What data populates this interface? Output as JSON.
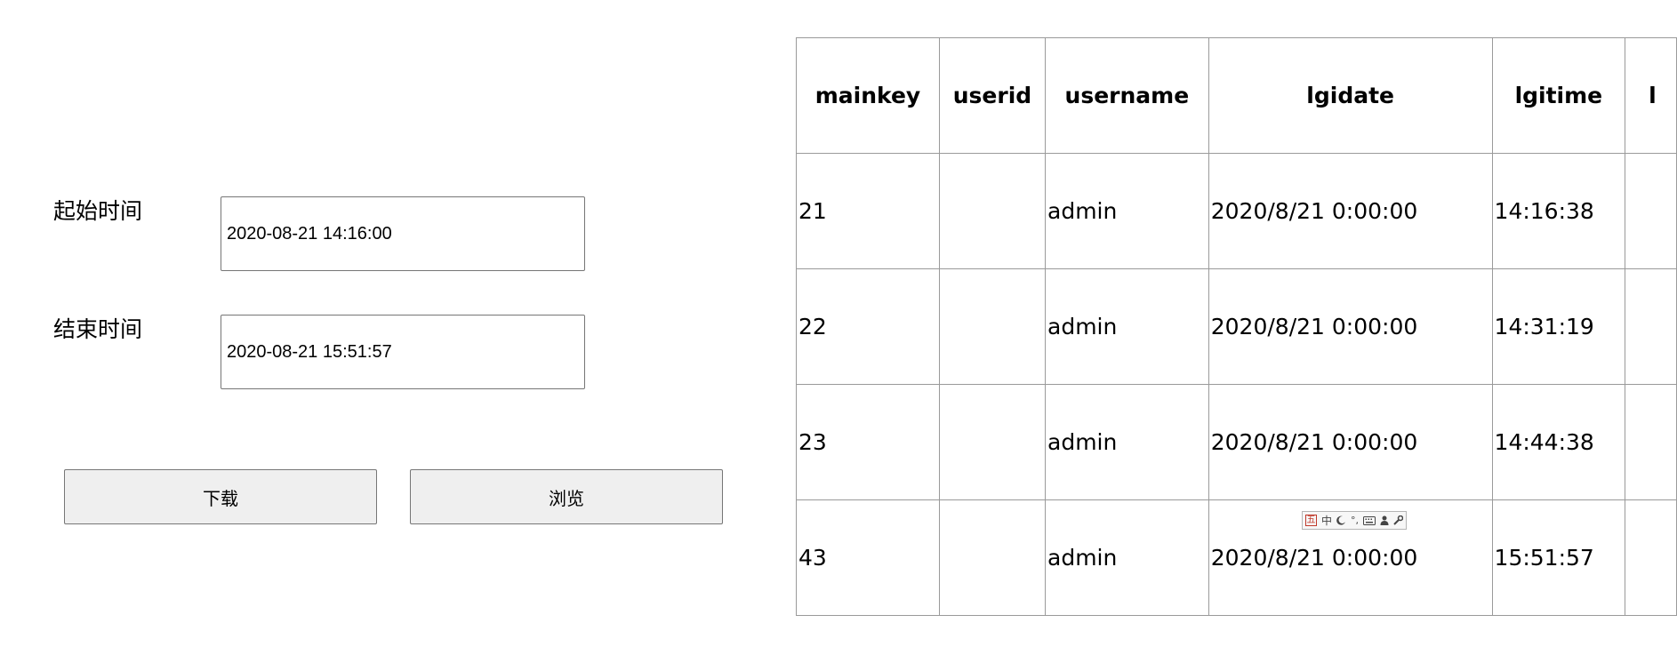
{
  "form": {
    "start_label": "起始时间",
    "start_value": "2020-08-21 14:16:00",
    "end_label": "结束时间",
    "end_value": "2020-08-21 15:51:57",
    "download_label": "下载",
    "browse_label": "浏览"
  },
  "table": {
    "headers": [
      "mainkey",
      "userid",
      "username",
      "lgidate",
      "lgitime",
      "l"
    ],
    "rows": [
      [
        "21",
        "",
        "admin",
        "2020/8/21 0:00:00",
        "14:16:38",
        ""
      ],
      [
        "22",
        "",
        "admin",
        "2020/8/21 0:00:00",
        "14:31:19",
        ""
      ],
      [
        "23",
        "",
        "admin",
        "2020/8/21 0:00:00",
        "14:44:38",
        ""
      ],
      [
        "43",
        "",
        "admin",
        "2020/8/21 0:00:00",
        "15:51:57",
        ""
      ]
    ]
  },
  "ime_toolbar": {
    "mode_label": "中",
    "icons": [
      "ime-logo-icon",
      "moon-icon",
      "punctuation-icon",
      "keyboard-icon",
      "user-icon",
      "wrench-icon"
    ]
  }
}
